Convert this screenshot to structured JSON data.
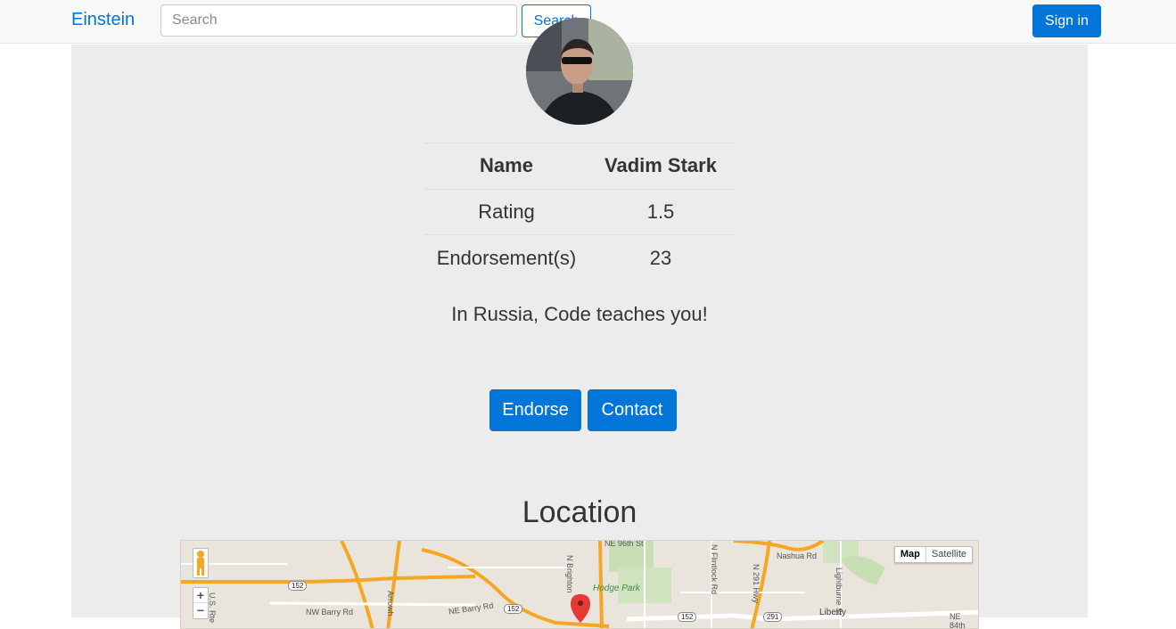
{
  "navbar": {
    "brand": "Einstein",
    "search_placeholder": "Search",
    "search_button": "Search",
    "signin_button": "Sign in"
  },
  "profile": {
    "table": {
      "header": {
        "label": "Name",
        "value": "Vadim Stark"
      },
      "rows": [
        {
          "label": "Rating",
          "value": "1.5"
        },
        {
          "label": "Endorsement(s)",
          "value": "23"
        }
      ]
    },
    "bio": "In Russia, Code teaches you!",
    "endorse_button": "Endorse",
    "contact_button": "Contact"
  },
  "location": {
    "heading": "Location",
    "map": {
      "type_map": "Map",
      "type_satellite": "Satellite",
      "zoom_in": "+",
      "zoom_out": "−",
      "labels": {
        "street_96th": "NE 96th St",
        "nashua": "Nashua Rd",
        "lightburne": "Lightburne St",
        "flintlock": "N Flintlock Rd",
        "route_291": "N 291 Hwy",
        "brighton": "N Brighton",
        "hodge_park": "Hodge Park",
        "barry": "NW Barry Rd",
        "ne_barry": "NE Barry Rd",
        "arrowhead": "Arrowh",
        "liberty": "Liberty",
        "us_route": "U.S. Rte",
        "ne_84th": "NE 84th",
        "shield_152_left": "152",
        "shield_152_mid": "152",
        "shield_152_right": "152",
        "shield_291": "291"
      }
    }
  }
}
